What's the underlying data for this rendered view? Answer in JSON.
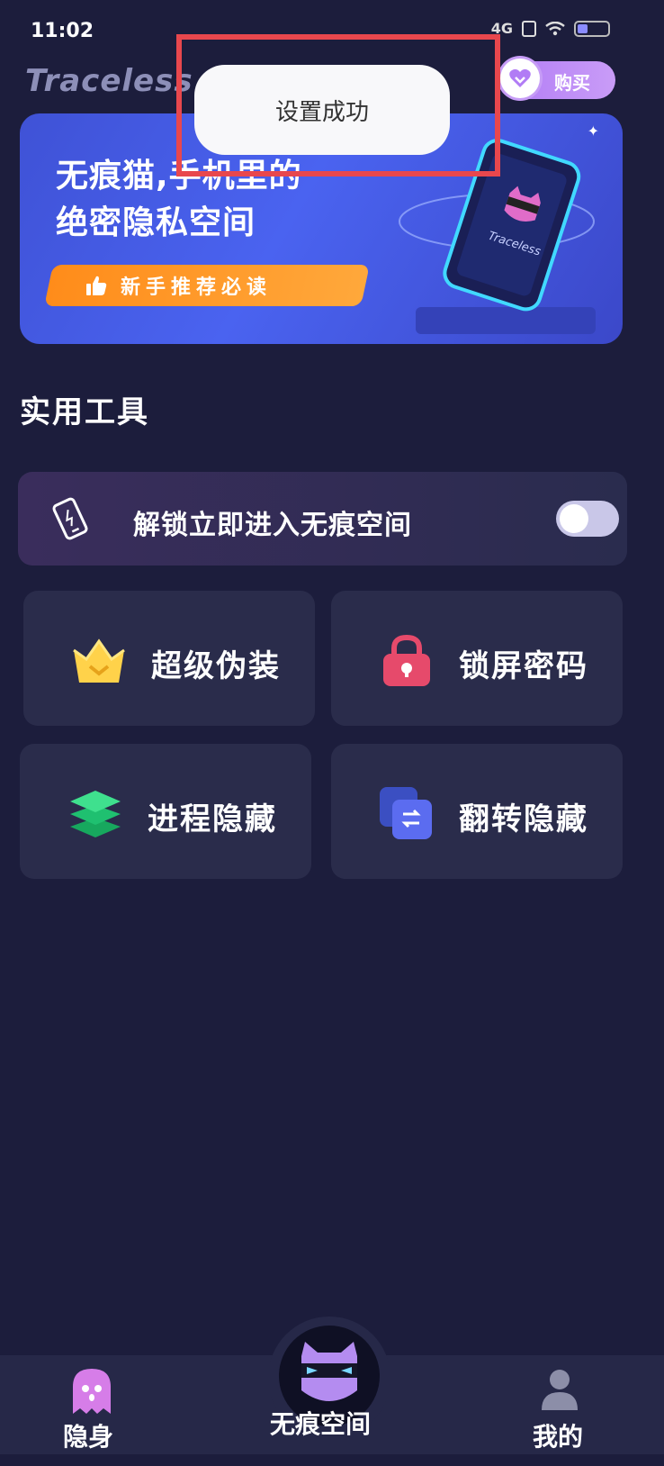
{
  "status_bar": {
    "time": "11:02",
    "signal": "4G"
  },
  "header": {
    "app_title": "Traceless",
    "buy_label": "购买"
  },
  "toast": {
    "message": "设置成功"
  },
  "banner": {
    "title_line1": "无痕猫,手机里的",
    "title_line2": "绝密隐私空间",
    "button_label": "新手推荐必读",
    "phone_caption": "Traceless"
  },
  "tools_section": {
    "title": "实用工具",
    "toggle": {
      "label": "解锁立即进入无痕空间",
      "enabled": false
    },
    "items": [
      {
        "label": "超级伪装",
        "icon": "crown-icon"
      },
      {
        "label": "锁屏密码",
        "icon": "lock-icon"
      },
      {
        "label": "进程隐藏",
        "icon": "layers-icon"
      },
      {
        "label": "翻转隐藏",
        "icon": "flip-icon"
      }
    ]
  },
  "bottom_nav": {
    "items": [
      {
        "label": "隐身",
        "icon": "ghost-icon"
      },
      {
        "label": "无痕空间",
        "icon": "cat-mask-icon"
      },
      {
        "label": "我的",
        "icon": "user-icon"
      }
    ]
  },
  "colors": {
    "background": "#1c1d3c",
    "accent_purple": "#b17cf5",
    "banner_blue": "#4a63f0",
    "orange": "#ff8c1a",
    "highlight_red": "#e8474d"
  }
}
